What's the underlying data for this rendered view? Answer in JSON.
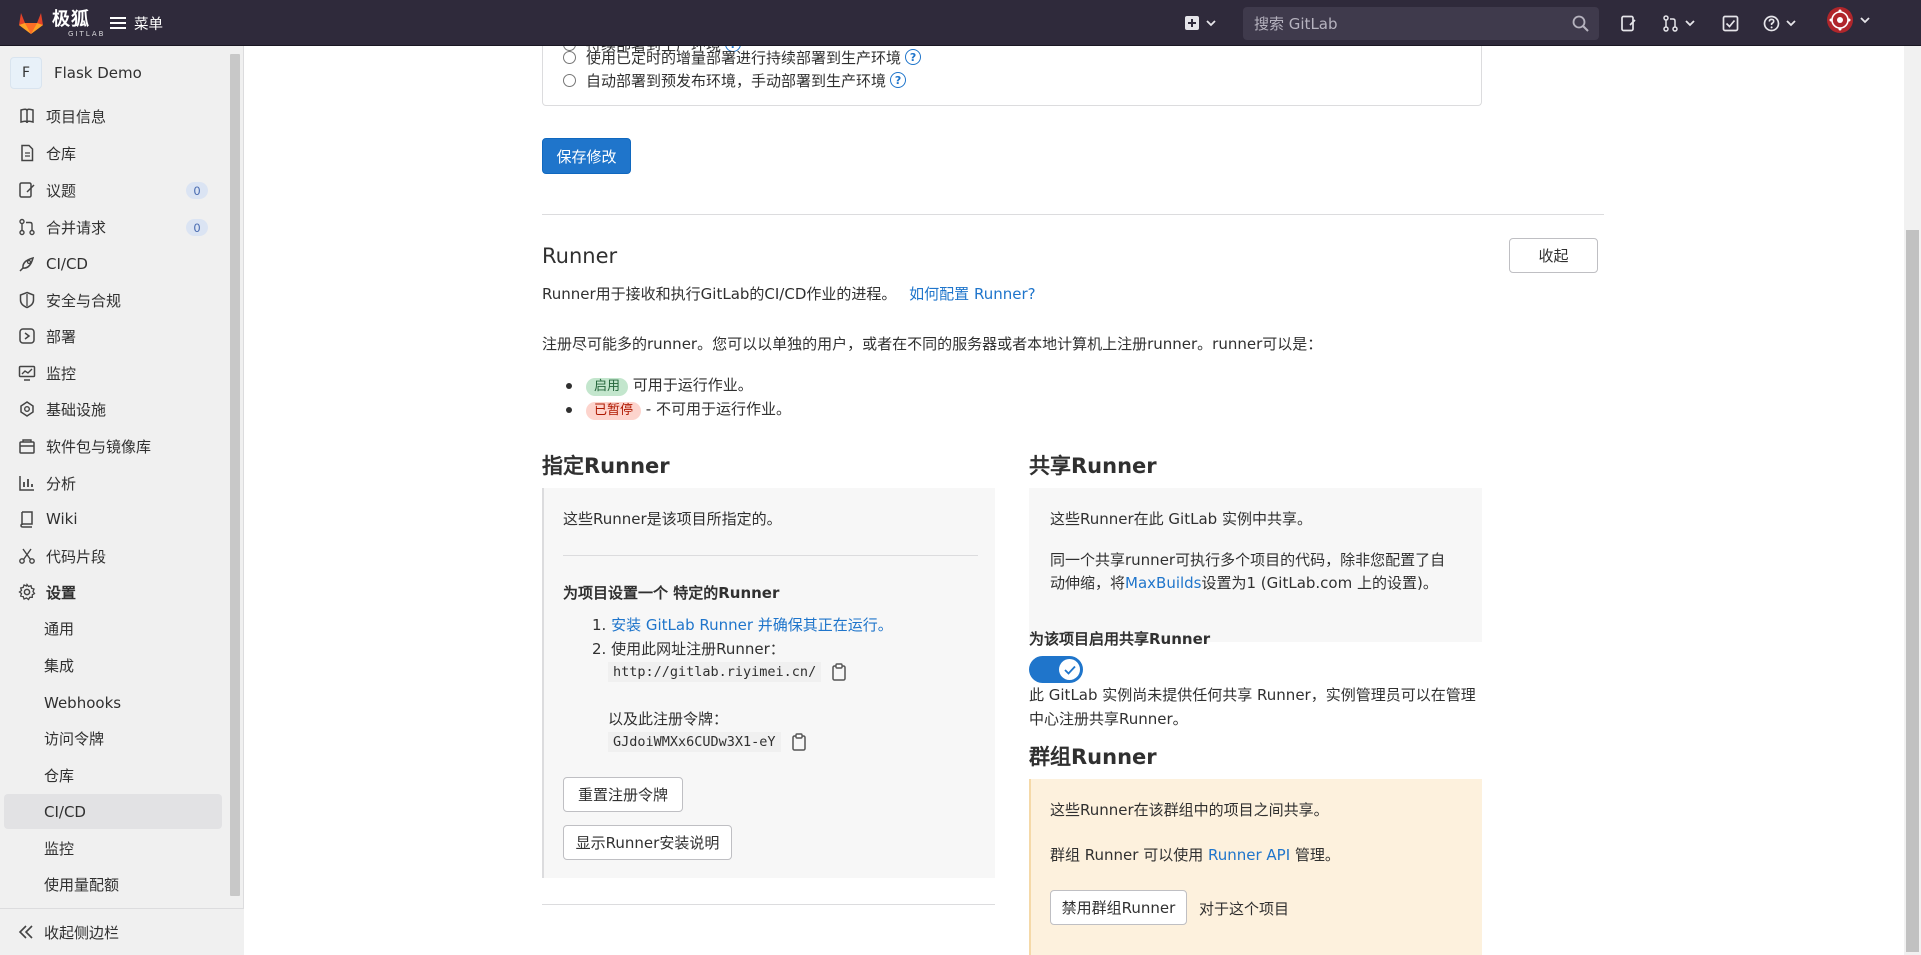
{
  "topbar": {
    "brand_cn": "极狐",
    "brand_en": "GITLAB",
    "menu_label": "菜单",
    "search_placeholder": "搜索 GitLab"
  },
  "sidebar": {
    "project_initial": "F",
    "project_name": "Flask Demo",
    "items": [
      {
        "label": "项目信息",
        "icon": "info-icon"
      },
      {
        "label": "仓库",
        "icon": "document-icon"
      },
      {
        "label": "议题",
        "icon": "issues-icon",
        "count": "0"
      },
      {
        "label": "合并请求",
        "icon": "merge-request-icon",
        "count": "0"
      },
      {
        "label": "CI/CD",
        "icon": "rocket-icon"
      },
      {
        "label": "安全与合规",
        "icon": "shield-icon"
      },
      {
        "label": "部署",
        "icon": "deployments-icon"
      },
      {
        "label": "监控",
        "icon": "monitor-icon"
      },
      {
        "label": "基础设施",
        "icon": "cloud-gear-icon"
      },
      {
        "label": "软件包与镜像库",
        "icon": "package-icon"
      },
      {
        "label": "分析",
        "icon": "chart-icon"
      },
      {
        "label": "Wiki",
        "icon": "book-icon"
      },
      {
        "label": "代码片段",
        "icon": "snippet-icon"
      },
      {
        "label": "设置",
        "icon": "gear-icon"
      }
    ],
    "sub_items": [
      "通用",
      "集成",
      "Webhooks",
      "访问令牌",
      "仓库",
      "CI/CD",
      "监控",
      "使用量配额"
    ],
    "active_sub": "CI/CD",
    "collapse_label": "收起侧边栏"
  },
  "deploy_options": {
    "option_partial": "持续部署到生产环境",
    "option_timed": "使用已定时的增量部署进行持续部署到生产环境",
    "option_staging": "自动部署到预发布环境，手动部署到生产环境"
  },
  "save_button": "保存修改",
  "runner": {
    "title": "Runner",
    "collapse_button": "收起",
    "description": "Runner用于接收和执行GitLab的CI/CD作业的进程。",
    "help_link": "如何配置 Runner?",
    "register_text": "注册尽可能多的runner。您可以以单独的用户，或者在不同的服务器或者本地计算机上注册runner。runner可以是：",
    "status_active_badge": "启用",
    "status_active_text": "可用于运行作业。",
    "status_paused_badge": "已暂停",
    "status_paused_text": "- 不可用于运行作业。"
  },
  "specific_runner": {
    "title": "指定Runner",
    "intro": "这些Runner是该项目所指定的。",
    "setup_title": "为项目设置一个 特定的Runner",
    "step1_link": "安装 GitLab Runner 并确保其正在运行。",
    "step1_num": "1.",
    "step2_num": "2.",
    "step2_text": "使用此网址注册Runner：",
    "url": "http://gitlab.riyimei.cn/",
    "token_label": "以及此注册令牌：",
    "token": "GJdoiWMXx6CUDw3X1-eY",
    "reset_token_button": "重置注册令牌",
    "show_install_button": "显示Runner安装说明"
  },
  "shared_runner": {
    "title": "共享Runner",
    "intro": "这些Runner在此 GitLab 实例中共享。",
    "desc_line1": "同一个共享runner可执行多个项目的代码，除非您配置了自",
    "desc_line2_a": "动伸缩，将",
    "desc_link": "MaxBuilds",
    "desc_line2_b": "设置为1 (GitLab.com 上的设置)。",
    "enable_label": "为该项目启用共享Runner",
    "toggle_on": true,
    "notice_line1": "此 GitLab 实例尚未提供任何共享 Runner，实例管理员可以在管理",
    "notice_line2": "中心注册共享Runner。"
  },
  "group_runner": {
    "title": "群组Runner",
    "intro": "这些Runner在该群组中的项目之间共享。",
    "api_text_a": "群组 Runner 可以使用 ",
    "api_link": "Runner API",
    "api_text_b": " 管理。",
    "disable_button": "禁用群组Runner",
    "for_project": "对于这个项目"
  },
  "colors": {
    "topbar_bg": "#2f2a3b",
    "primary": "#1f75cb",
    "sidebar_bg": "#f0f0f0"
  }
}
